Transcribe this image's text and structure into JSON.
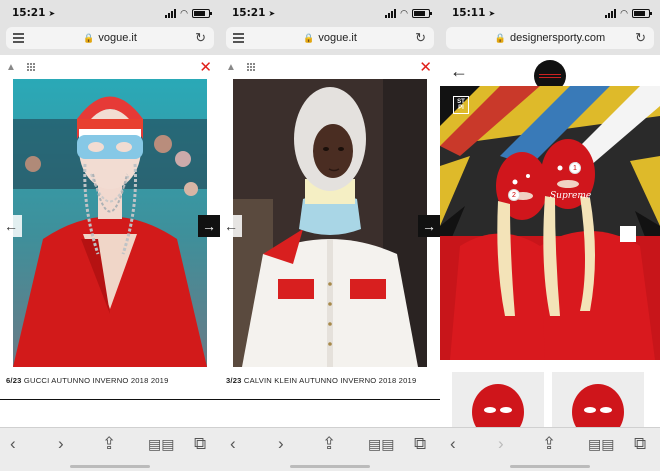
{
  "panels": [
    {
      "status": {
        "time": "15:21"
      },
      "url": "vogue.it",
      "caption": {
        "index": "6/23",
        "text": "GUCCI AUTUNNO INVERNO 2018 2019"
      }
    },
    {
      "status": {
        "time": "15:21"
      },
      "url": "vogue.it",
      "caption": {
        "index": "3/23",
        "text": "CALVIN KLEIN AUTUNNO INVERNO 2018 2019"
      }
    },
    {
      "status": {
        "time": "15:11"
      },
      "url": "designersporty.com",
      "badge": "ST\nPI",
      "pins": [
        "1",
        "2"
      ]
    }
  ],
  "icons": {
    "prev_arrow": "←",
    "next_arrow": "→",
    "close": "✕",
    "reload": "↻",
    "lock": "🔒",
    "back": "‹",
    "forward": "›",
    "share": "⇪",
    "bookmarks": "📖",
    "tabs": "⧉"
  },
  "colors": {
    "accent_red": "#e0201a",
    "chrome_gray": "#e3e3e3"
  }
}
